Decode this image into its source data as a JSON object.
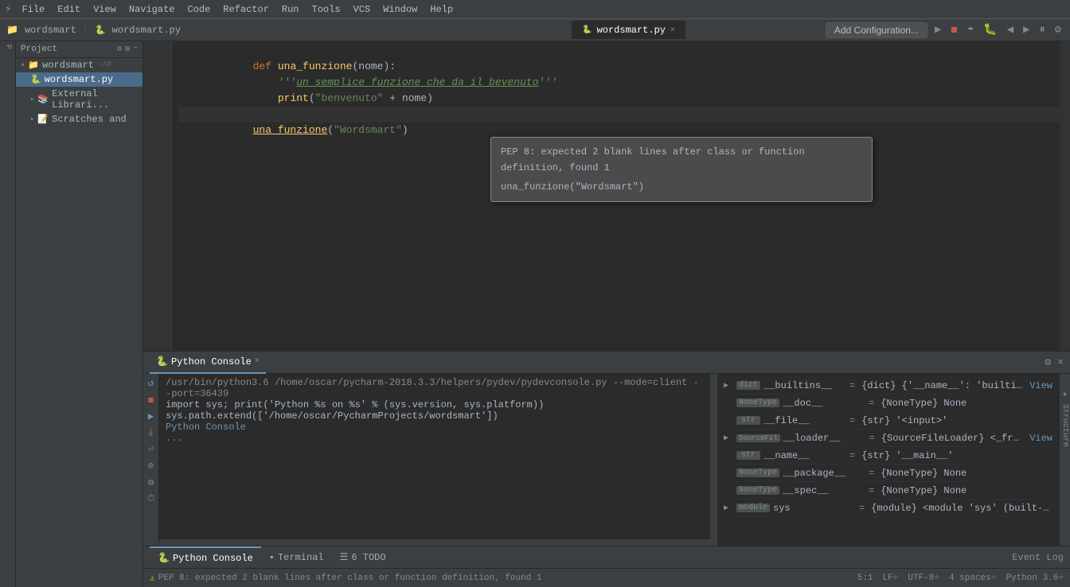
{
  "menubar": {
    "items": [
      "File",
      "Edit",
      "View",
      "Navigate",
      "Code",
      "Refactor",
      "Run",
      "Tools",
      "VCS",
      "Window",
      "Help"
    ]
  },
  "titlebar": {
    "project": "wordsmart",
    "file": "wordsmart.py",
    "tabs": [
      {
        "label": "wordsmart.py",
        "active": true,
        "icon": "🐍"
      }
    ],
    "run_config_label": "Add Configuration..."
  },
  "project_panel": {
    "label": "Project",
    "items": [
      {
        "label": "wordsmart",
        "type": "folder",
        "path": "~/P",
        "level": 0,
        "expanded": true
      },
      {
        "label": "wordsmart.py",
        "type": "file",
        "level": 1,
        "selected": true
      },
      {
        "label": "External Librari...",
        "type": "external",
        "level": 1
      },
      {
        "label": "Scratches and",
        "type": "scratch",
        "level": 1
      }
    ]
  },
  "editor": {
    "lines": [
      {
        "num": "",
        "code": "def una_funzione(nome):",
        "parts": [
          {
            "text": "def ",
            "class": "kw"
          },
          {
            "text": "una_funzione",
            "class": "fn-name"
          },
          {
            "text": "(nome):",
            "class": ""
          }
        ]
      },
      {
        "num": "",
        "code": "    '''un semplice funzione che da il bevenuto'''",
        "parts": [
          {
            "text": "    ",
            "class": ""
          },
          {
            "text": "'''un semplice funzione che da il bevenuto'''",
            "class": "string doc"
          }
        ]
      },
      {
        "num": "",
        "code": "    print(\"benvenuto\" + nome)",
        "parts": [
          {
            "text": "    ",
            "class": ""
          },
          {
            "text": "print",
            "class": "call"
          },
          {
            "text": "(",
            "class": ""
          },
          {
            "text": "\"benvenuto\"",
            "class": "str-val"
          },
          {
            "text": " + nome)",
            "class": ""
          }
        ]
      },
      {
        "num": "",
        "code": "",
        "parts": []
      },
      {
        "num": "",
        "code": "una_funzione(\"Wordsmart\")",
        "parts": [
          {
            "text": "una_funzione",
            "class": "call underline"
          },
          {
            "text": "(",
            "class": ""
          },
          {
            "text": "\"Wordsmart\"",
            "class": "str-val"
          },
          {
            "text": ")",
            "class": ""
          }
        ],
        "current": true
      }
    ],
    "tooltip": {
      "line1": "PEP 8: expected 2 blank lines after class or function definition, found 1",
      "line2": "una_funzione(\"Wordsmart\")"
    }
  },
  "console": {
    "tab_label": "Python Console",
    "tab_close": "×",
    "cmd_line": "/usr/bin/python3.6 /home/oscar/pycharm-2018.3.3/helpers/pydev/pydevconsole.py --mode=client --port=36439",
    "import_line": "import sys; print('Python %s on %s' % (sys.version, sys.platform))",
    "path_line": "sys.path.extend(['/home/oscar/PycharmProjects/wordsmart'])",
    "label": "Python Console",
    "prompt": "..."
  },
  "variables": [
    {
      "arrow": "▶",
      "badge": "dict",
      "name": "__builtins__",
      "eq": "=",
      "value": "{dict} {'__name__': 'builtins', '__doc...",
      "link": "View"
    },
    {
      "arrow": "",
      "badge": "NoneType",
      "name": "__doc__",
      "eq": "=",
      "value": "{NoneType} None",
      "link": ""
    },
    {
      "arrow": "",
      "badge": "str",
      "name": "__file__",
      "eq": "=",
      "value": "{str} '<input>'",
      "link": ""
    },
    {
      "arrow": "▶",
      "badge": "SourceFil",
      "name": "__loader__",
      "eq": "=",
      "value": "{SourceFileLoader} <_frozen_impor...",
      "link": "View"
    },
    {
      "arrow": "",
      "badge": "str",
      "name": "__name__",
      "eq": "=",
      "value": "{str} '__main__'",
      "link": ""
    },
    {
      "arrow": "",
      "badge": "NoneType",
      "name": "__package__",
      "eq": "=",
      "value": "{NoneType} None",
      "link": ""
    },
    {
      "arrow": "",
      "badge": "NoneType",
      "name": "__spec__",
      "eq": "=",
      "value": "{NoneType} None",
      "link": ""
    },
    {
      "arrow": "▶",
      "badge": "module",
      "name": "sys",
      "eq": "=",
      "value": "{module} <module 'sys' (built-in)>",
      "link": ""
    }
  ],
  "bottom_tabs": [
    {
      "label": "Python Console",
      "active": true,
      "icon": "🐍"
    },
    {
      "label": "Terminal",
      "active": false,
      "icon": "▪"
    },
    {
      "label": "6  TODO",
      "active": false,
      "icon": "☰"
    }
  ],
  "statusbar": {
    "warning": "PEP 8: expected 2 blank lines after class or function definition, found 1",
    "position": "5:1",
    "lf": "LF÷",
    "encoding": "UTF-8÷",
    "indent": "4 spaces÷",
    "python": "Python 3.6÷"
  },
  "icons": {
    "run": "▶",
    "stop": "◼",
    "gear": "⚙",
    "close": "×",
    "expand": "▸",
    "collapse": "▾",
    "plus": "+",
    "minus": "−",
    "settings": "⚙",
    "event_log": "Event Log"
  }
}
